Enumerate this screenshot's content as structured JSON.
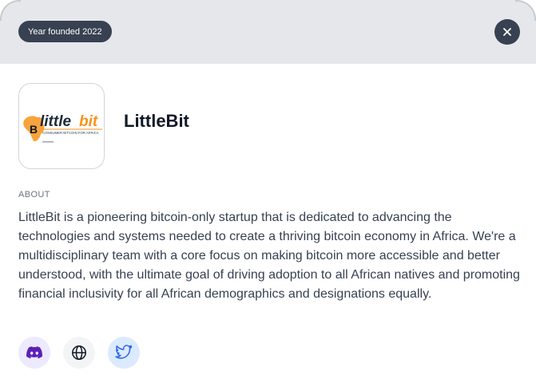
{
  "header": {
    "founded_badge": "Year founded 2022"
  },
  "company": {
    "name": "LittleBit",
    "logo": {
      "wordmark": "littlebit",
      "tagline": "CONSUMER BITCOIN FOR AFRICA",
      "colors": {
        "brand_orange": "#f7931a",
        "text": "#1f2937"
      }
    }
  },
  "about": {
    "label": "ABOUT",
    "text": "LittleBit is a pioneering bitcoin-only startup that is dedicated to advancing the technologies and systems needed to create a thriving bitcoin economy in Africa. We're a multidisciplinary team with a core focus on making bitcoin more accessible and better understood, with the ultimate goal of driving adoption to all African natives and promoting financial inclusivity for all African demographics and designations equally."
  },
  "social_links": [
    {
      "icon": "discord-icon",
      "color": "#5b21b6"
    },
    {
      "icon": "globe-icon",
      "color": "#111827"
    },
    {
      "icon": "twitter-icon",
      "color": "#2563eb"
    }
  ]
}
